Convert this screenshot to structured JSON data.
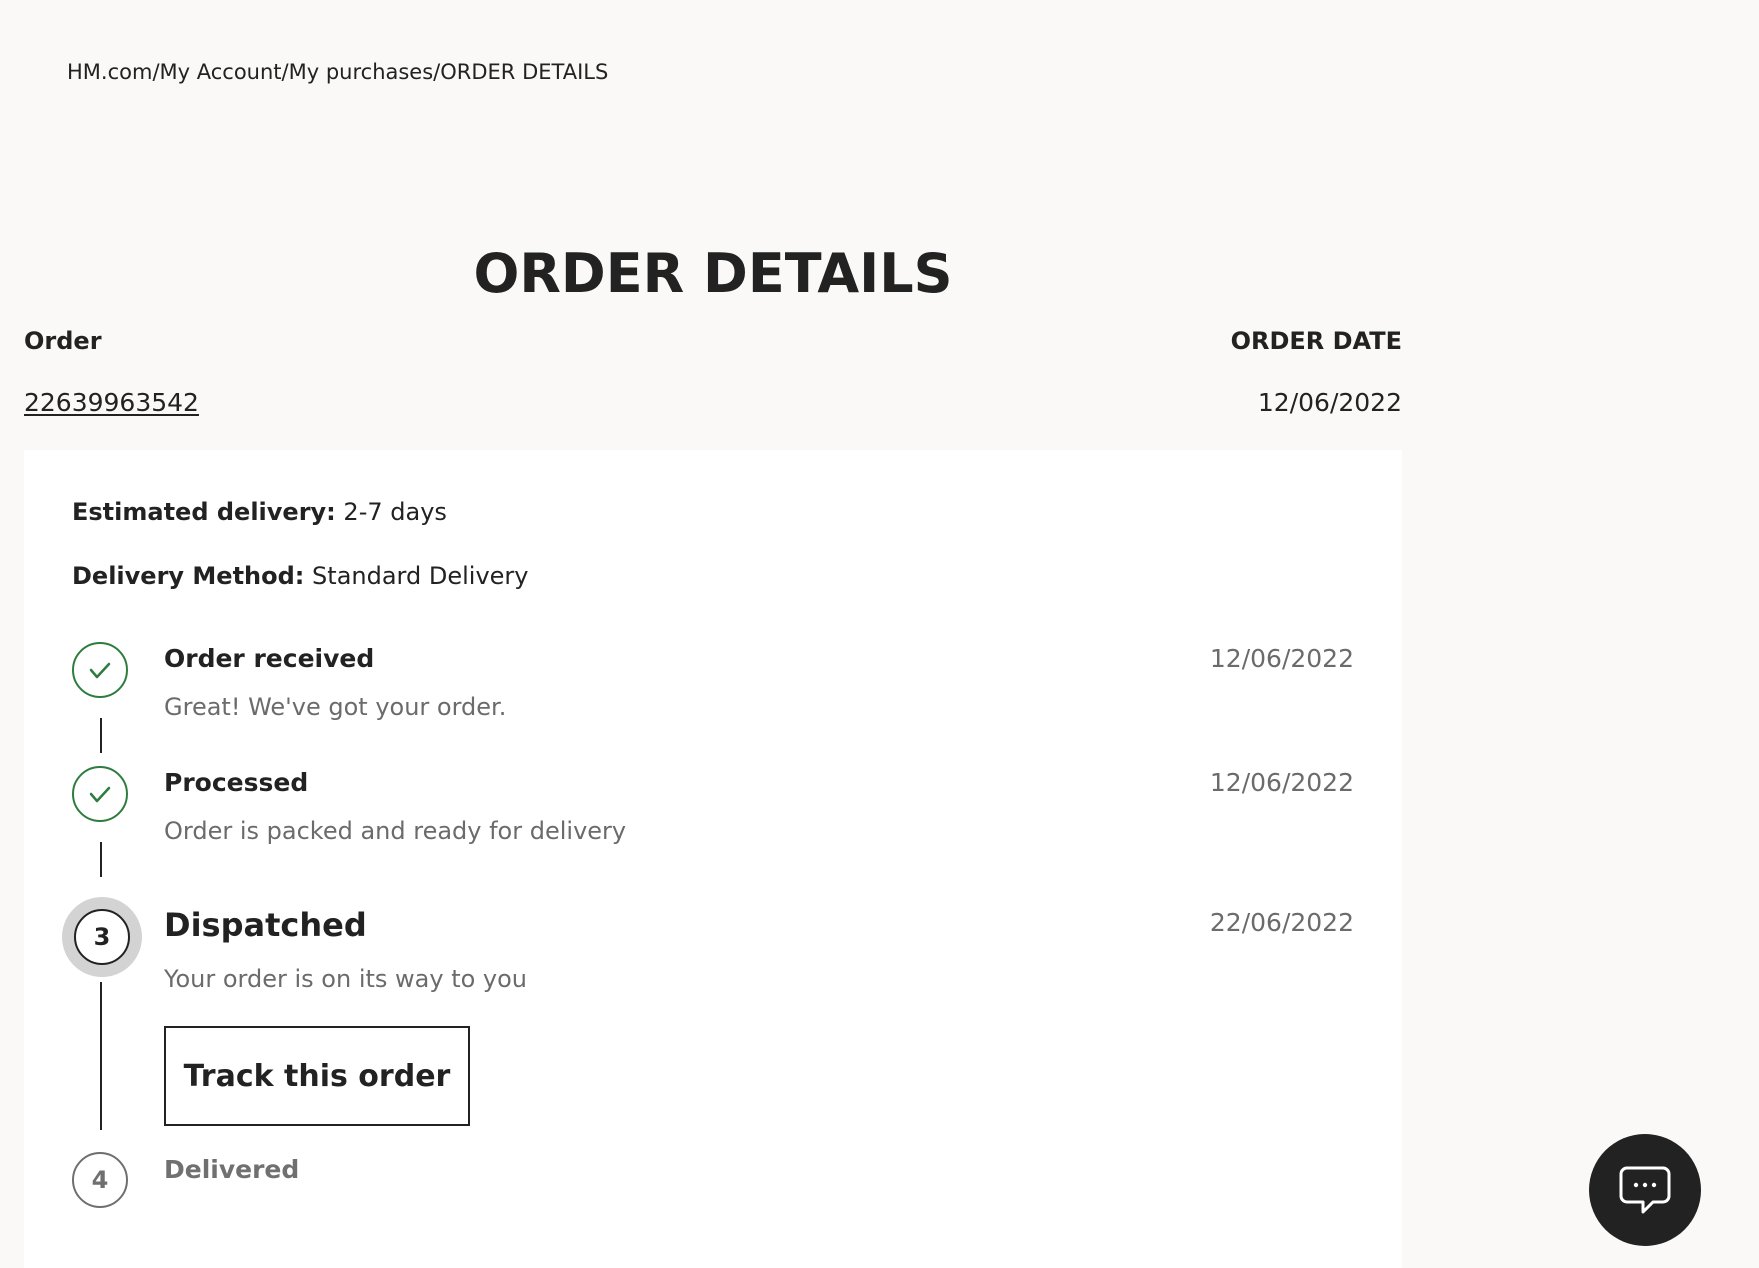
{
  "breadcrumb": {
    "items": [
      "HM.com",
      "My Account",
      "My purchases",
      "ORDER DETAILS"
    ],
    "separator": "/"
  },
  "page": {
    "title": "ORDER DETAILS"
  },
  "order": {
    "number_label": "Order",
    "number": "22639963542",
    "date_label": "ORDER DATE",
    "date": "12/06/2022"
  },
  "delivery": {
    "estimated_label": "Estimated delivery:",
    "estimated_value": "2-7 days",
    "method_label": "Delivery Method:",
    "method_value": "Standard Delivery"
  },
  "steps": [
    {
      "status": "done",
      "marker": "check-icon",
      "title": "Order received",
      "description": "Great! We've got your order.",
      "date": "12/06/2022"
    },
    {
      "status": "done",
      "marker": "check-icon",
      "title": "Processed",
      "description": "Order is packed and ready for delivery",
      "date": "12/06/2022"
    },
    {
      "status": "current",
      "marker": "3",
      "title": "Dispatched",
      "description": "Your order is on its way to you",
      "date": "22/06/2022",
      "action_label": "Track this order"
    },
    {
      "status": "pending",
      "marker": "4",
      "title": "Delivered"
    }
  ],
  "chat": {
    "icon": "chat-bubble-icon"
  },
  "colors": {
    "page_background": "#faf9f8",
    "card_background": "#ffffff",
    "text": "#222222",
    "muted_text": "#6b6b6b",
    "success_green": "#2e7d3e",
    "current_halo": "#d3d3d3",
    "chat_button": "#222222"
  }
}
